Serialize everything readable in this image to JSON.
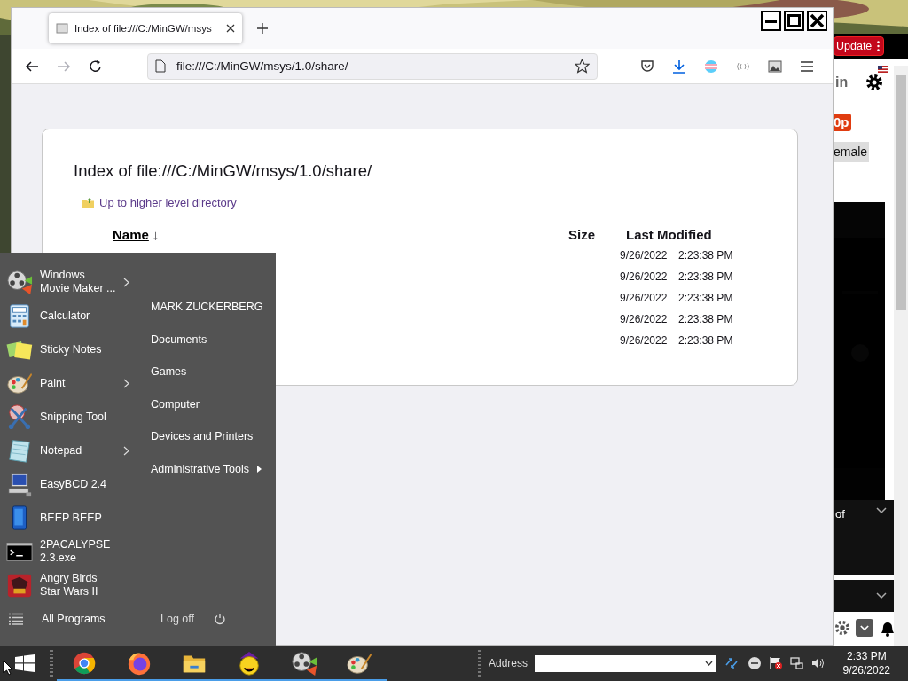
{
  "browser": {
    "tab": {
      "title": "Index of file:///C:/MinGW/msys",
      "selected": true
    },
    "nav": {
      "forward_disabled": true
    },
    "url": "file:///C:/MinGW/msys/1.0/share/",
    "page": {
      "heading": "Index of file:///C:/MinGW/msys/1.0/share/",
      "up_link": "Up to higher level directory",
      "columns": [
        {
          "label": "Name",
          "sort": "↓"
        },
        {
          "label": "Size"
        },
        {
          "label": "Last Modified"
        }
      ],
      "rows": [
        {
          "date": "9/26/2022",
          "time": "2:23:38 PM"
        },
        {
          "date": "9/26/2022",
          "time": "2:23:38 PM"
        },
        {
          "date": "9/26/2022",
          "time": "2:23:38 PM"
        },
        {
          "date": "9/26/2022",
          "time": "2:23:38 PM"
        },
        {
          "date": "9/26/2022",
          "time": "2:23:38 PM"
        }
      ]
    }
  },
  "side_window": {
    "update_button": "Update",
    "sign_in_fragment": "in",
    "badge": "0p",
    "chip": "emale",
    "panel_text": "of"
  },
  "start_menu": {
    "programs": [
      {
        "label": "Windows\nMovie Maker ...",
        "kind": "moviemaker",
        "submenu": true
      },
      {
        "label": "Calculator",
        "kind": "calculator",
        "submenu": false
      },
      {
        "label": "Sticky Notes",
        "kind": "sticky",
        "submenu": false
      },
      {
        "label": "Paint",
        "kind": "paint",
        "submenu": true
      },
      {
        "label": "Snipping Tool",
        "kind": "snipping",
        "submenu": false
      },
      {
        "label": "Notepad",
        "kind": "notepad",
        "submenu": true
      },
      {
        "label": "EasyBCD 2.4",
        "kind": "easybcd",
        "submenu": false
      },
      {
        "label": "BEEP BEEP",
        "kind": "beep",
        "submenu": false
      },
      {
        "label": "2PACALYPSE\n2.3.exe",
        "kind": "console",
        "submenu": false
      },
      {
        "label": "Angry Birds\nStar Wars II",
        "kind": "angrybirds",
        "submenu": false
      }
    ],
    "places": [
      {
        "label": "MARK ZUCKERBERG",
        "submenu": false
      },
      {
        "label": "Documents",
        "submenu": false
      },
      {
        "label": "Games",
        "submenu": false
      },
      {
        "label": "Computer",
        "submenu": false
      },
      {
        "label": "Devices and Printers",
        "submenu": false
      },
      {
        "label": "Administrative Tools",
        "submenu": true
      }
    ],
    "all_programs": "All Programs",
    "log_off": "Log off"
  },
  "taskbar": {
    "apps": [
      {
        "kind": "chrome",
        "running": true
      },
      {
        "kind": "firefox",
        "running": true
      },
      {
        "kind": "folder",
        "running": true
      },
      {
        "kind": "yahoo",
        "running": true
      },
      {
        "kind": "moviemaker",
        "running": true
      },
      {
        "kind": "paint",
        "running": true
      }
    ],
    "address_label": "Address",
    "time": "2:33 PM",
    "date": "9/26/2022"
  }
}
